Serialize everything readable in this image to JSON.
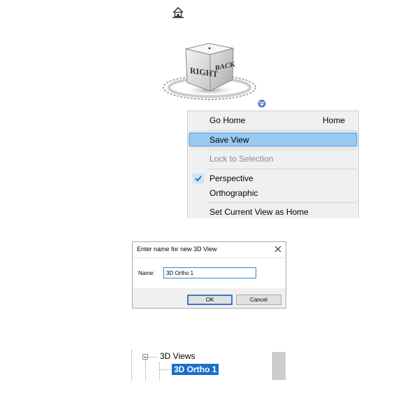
{
  "context_menu": {
    "items": [
      {
        "label": "Go Home",
        "shortcut": "Home"
      },
      {
        "label": "Save View",
        "highlighted": true
      },
      {
        "label": "Lock to Selection",
        "disabled": true
      },
      {
        "label": "Perspective",
        "checked": true
      },
      {
        "label": "Orthographic"
      },
      {
        "label": "Set Current View as Home"
      }
    ]
  },
  "viewcube": {
    "face_right": "RIGHT",
    "face_back": "BACK",
    "icons": [
      "home-icon",
      "viewcube-menu-icon"
    ]
  },
  "dialog": {
    "title": "Enter name for new 3D View",
    "name_label": "Name:",
    "name_value": "3D Ortho 1",
    "ok_label": "OK",
    "cancel_label": "Cancel"
  },
  "project_browser": {
    "folder_label": "3D Views",
    "selected_item": "3D Ortho 1"
  },
  "colors": {
    "highlight": "#99c9ef",
    "selection": "#1a6fc9",
    "menu_bg": "#f0f0f0"
  }
}
